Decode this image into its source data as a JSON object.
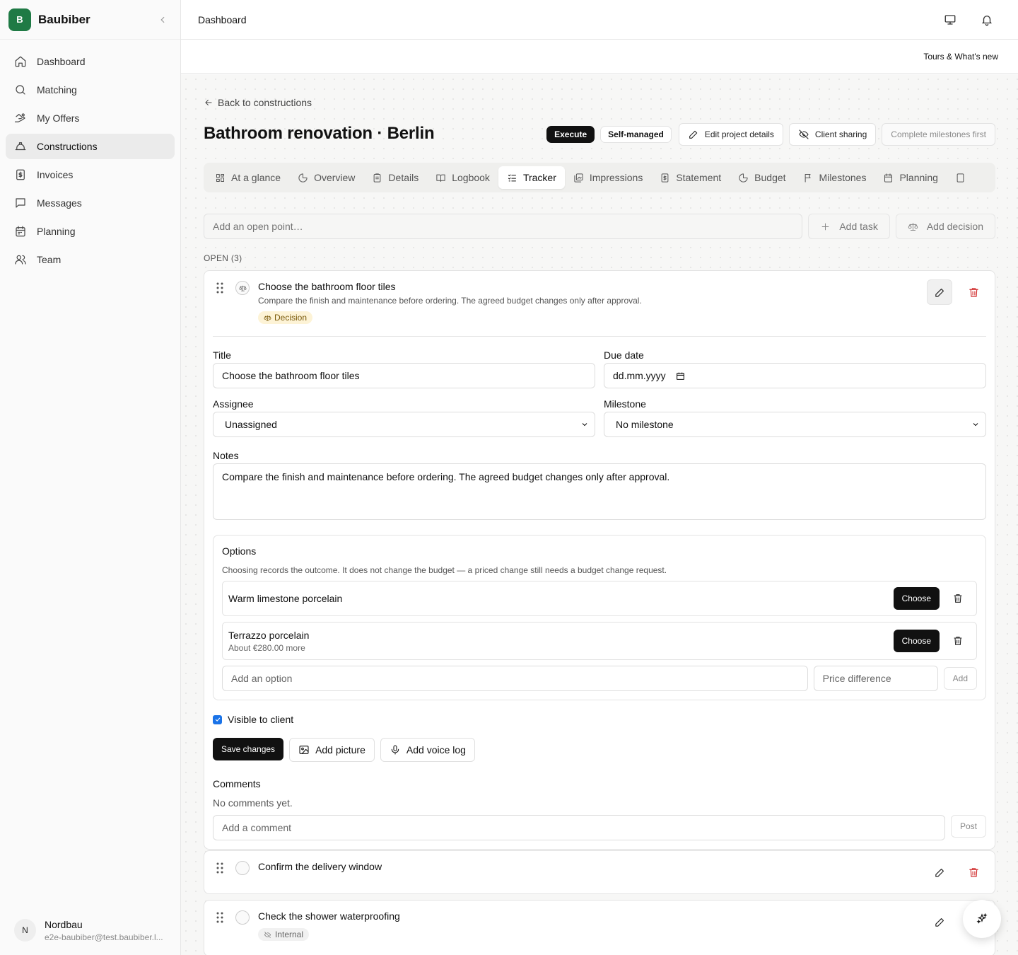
{
  "app": {
    "brand_initial": "B",
    "brand_name": "Baubiber",
    "accent_color": "#1f7a45"
  },
  "sidebar": {
    "items": [
      {
        "label": "Dashboard",
        "icon": "home-icon"
      },
      {
        "label": "Matching",
        "icon": "search-icon"
      },
      {
        "label": "My Offers",
        "icon": "offers-icon"
      },
      {
        "label": "Constructions",
        "icon": "hardhat-icon",
        "active": true
      },
      {
        "label": "Invoices",
        "icon": "invoice-icon"
      },
      {
        "label": "Messages",
        "icon": "message-icon"
      },
      {
        "label": "Planning",
        "icon": "calendar-icon"
      },
      {
        "label": "Team",
        "icon": "team-icon"
      }
    ],
    "user": {
      "initial": "N",
      "name": "Nordbau",
      "email": "e2e-baubiber@test.baubiber.l..."
    }
  },
  "topbar": {
    "title": "Dashboard",
    "tours_label": "Tours & What's new"
  },
  "page": {
    "back_label": "Back to constructions",
    "title": "Bathroom renovation · Berlin",
    "status_badge": "Execute",
    "mode_badge": "Self-managed",
    "edit_label": "Edit project details",
    "share_label": "Client sharing",
    "complete_label": "Complete milestones first"
  },
  "tabs": [
    {
      "label": "At a glance",
      "icon": "grid-icon"
    },
    {
      "label": "Overview",
      "icon": "pie-icon"
    },
    {
      "label": "Details",
      "icon": "clipboard-icon"
    },
    {
      "label": "Logbook",
      "icon": "book-icon"
    },
    {
      "label": "Tracker",
      "icon": "checklist-icon",
      "active": true
    },
    {
      "label": "Impressions",
      "icon": "images-icon"
    },
    {
      "label": "Statement",
      "icon": "statement-icon"
    },
    {
      "label": "Budget",
      "icon": "pie-icon"
    },
    {
      "label": "Milestones",
      "icon": "flag-icon"
    },
    {
      "label": "Planning",
      "icon": "calendar-icon"
    }
  ],
  "tracker": {
    "add_placeholder": "Add an open point…",
    "add_task_label": "Add task",
    "add_decision_label": "Add decision",
    "open_label": "OPEN (3)",
    "item1": {
      "title": "Choose the bathroom floor tiles",
      "description": "Compare the finish and maintenance before ordering. The agreed budget changes only after approval.",
      "badge": "Decision",
      "form": {
        "title_label": "Title",
        "title_value": "Choose the bathroom floor tiles",
        "due_label": "Due date",
        "due_value": "dd.mm.yyyy",
        "assignee_label": "Assignee",
        "assignee_value": "Unassigned",
        "milestone_label": "Milestone",
        "milestone_value": "No milestone",
        "notes_label": "Notes",
        "notes_value": "Compare the finish and maintenance before ordering. The agreed budget changes only after approval."
      },
      "options": {
        "title": "Options",
        "hint": "Choosing records the outcome. It does not change the budget — a priced change still needs a budget change request.",
        "list": [
          {
            "name": "Warm limestone porcelain",
            "sub": ""
          },
          {
            "name": "Terrazzo porcelain",
            "sub": "About €280.00 more"
          }
        ],
        "choose_label": "Choose",
        "add_option_placeholder": "Add an option",
        "price_placeholder": "Price difference",
        "add_label": "Add"
      },
      "visible_label": "Visible to client",
      "visible_checked": true,
      "save_label": "Save changes",
      "add_picture_label": "Add picture",
      "add_voice_label": "Add voice log",
      "comments_label": "Comments",
      "comments_empty": "No comments yet.",
      "comment_placeholder": "Add a comment",
      "post_label": "Post"
    },
    "item2": {
      "title": "Confirm the delivery window"
    },
    "item3": {
      "title": "Check the shower waterproofing",
      "badge": "Internal"
    }
  }
}
